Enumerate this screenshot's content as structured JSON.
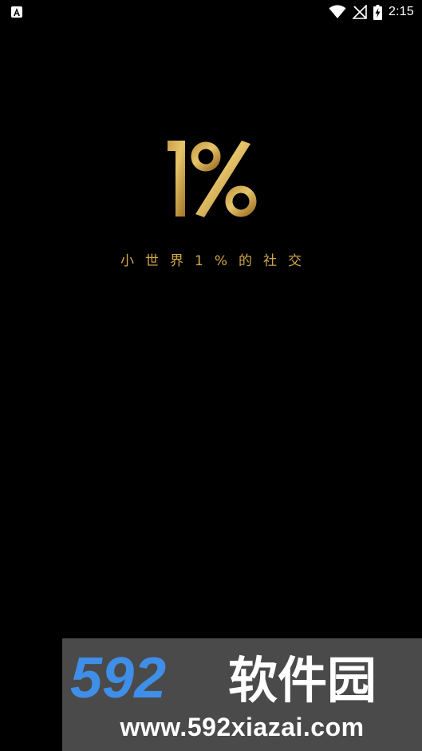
{
  "status_bar": {
    "time": "2:15",
    "left_icon": "app-notification-icon",
    "right_icons": [
      "wifi-icon",
      "no-signal-icon",
      "battery-charging-icon"
    ]
  },
  "splash": {
    "logo_text": "1%",
    "tagline": "小世界1%的社交",
    "accent_color": "#d4a84b"
  },
  "watermark": {
    "brand_number": "592",
    "brand_text": "软件园",
    "url": "www.592xiazai.com",
    "number_color": "#3f8ee8"
  }
}
